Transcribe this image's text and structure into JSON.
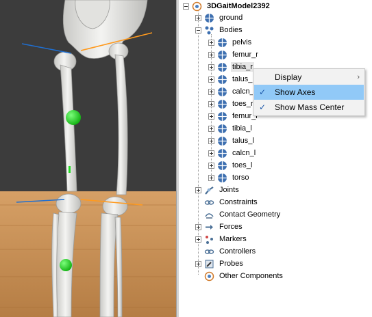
{
  "tree": {
    "root": {
      "label": "3DGaitModel2392",
      "icon": "model-icon"
    },
    "items": [
      {
        "label": "ground",
        "icon": "body-icon"
      },
      {
        "label": "Bodies",
        "icon": "bodies-icon"
      },
      {
        "label": "pelvis",
        "icon": "body-icon"
      },
      {
        "label": "femur_r",
        "icon": "body-icon"
      },
      {
        "label": "tibia_r",
        "icon": "body-icon"
      },
      {
        "label": "talus_r",
        "icon": "body-icon"
      },
      {
        "label": "calcn_r",
        "icon": "body-icon"
      },
      {
        "label": "toes_r",
        "icon": "body-icon"
      },
      {
        "label": "femur_l",
        "icon": "body-icon"
      },
      {
        "label": "tibia_l",
        "icon": "body-icon"
      },
      {
        "label": "talus_l",
        "icon": "body-icon"
      },
      {
        "label": "calcn_l",
        "icon": "body-icon"
      },
      {
        "label": "toes_l",
        "icon": "body-icon"
      },
      {
        "label": "torso",
        "icon": "body-icon"
      },
      {
        "label": "Joints",
        "icon": "joints-icon"
      },
      {
        "label": "Constraints",
        "icon": "constraints-icon"
      },
      {
        "label": "Contact Geometry",
        "icon": "contact-geometry-icon"
      },
      {
        "label": "Forces",
        "icon": "forces-icon"
      },
      {
        "label": "Markers",
        "icon": "markers-icon"
      },
      {
        "label": "Controllers",
        "icon": "controllers-icon"
      },
      {
        "label": "Probes",
        "icon": "probes-icon"
      },
      {
        "label": "Other Components",
        "icon": "model-icon"
      }
    ]
  },
  "context_menu": {
    "items": [
      {
        "label": "Display",
        "submenu_arrow": "›"
      },
      {
        "label": "Show Axes",
        "check": "✓"
      },
      {
        "label": "Show Mass Center",
        "check": "✓"
      }
    ]
  },
  "colors": {
    "sky": "#3c3c3c",
    "floor": "#c08a4d",
    "bone": "#ebebe8",
    "mass_center": "#22dd22",
    "axis_blue": "#1f6fd1",
    "axis_orange": "#ff9a1e",
    "menu_highlight": "#91c9f7"
  }
}
